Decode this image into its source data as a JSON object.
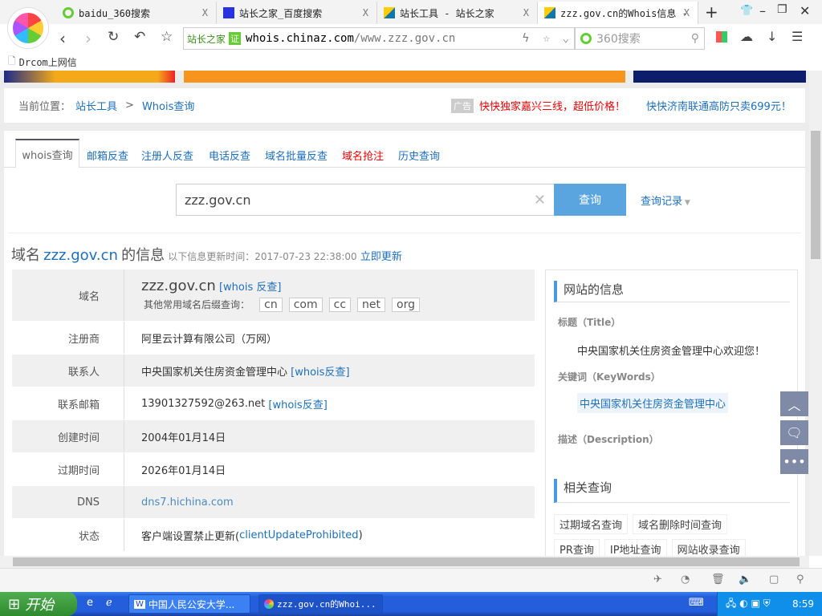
{
  "browser": {
    "tabs": [
      {
        "label": "baidu_360搜索",
        "close": "X"
      },
      {
        "label": "站长之家_百度搜索",
        "close": "X"
      },
      {
        "label": "站长工具 - 站长之家",
        "close": "X"
      },
      {
        "label": "zzz.gov.cn的Whois信息 -",
        "close": "X",
        "active": true
      }
    ],
    "new_tab": "+",
    "address_badge": "站长之家",
    "address_badge_icon": "证",
    "address_host": "whois.chinaz.com",
    "address_path": "/www.zzz.gov.cn",
    "search_placeholder": "360搜索",
    "bookmark": "Drcom上网信"
  },
  "page": {
    "breadcrumb_label": "当前位置：",
    "breadcrumb": [
      "站长工具",
      "Whois查询"
    ],
    "breadcrumb_sep": ">",
    "ad_tag": "广告",
    "ad1": "快快独家嘉兴三线，超低价格！",
    "ad2": "快快济南联通高防只卖699元！",
    "tabs": [
      "whois查询",
      "邮箱反查",
      "注册人反查",
      "电话反查",
      "域名批量反查",
      "域名抢注",
      "历史查询"
    ],
    "query_value": "zzz.gov.cn",
    "query_button": "查询",
    "history": "查询记录",
    "title_prefix": "域名",
    "title_domain": "zzz.gov.cn",
    "title_suffix": "的信息",
    "update_label": "以下信息更新时间：2017-07-23 22:38:00",
    "update_link": "立即更新",
    "domain_row": {
      "label": "域名",
      "value": "zzz.gov.cn",
      "reverse": "[whois 反查]",
      "suffix_label": "其他常用域名后缀查询：",
      "suffixes": [
        "cn",
        "com",
        "cc",
        "net",
        "org"
      ]
    },
    "rows": [
      {
        "label": "注册商",
        "value": "阿里云计算有限公司（万网）"
      },
      {
        "label": "联系人",
        "value": "中央国家机关住房资金管理中心",
        "link": "[whois反查]"
      },
      {
        "label": "联系邮箱",
        "value": "13901327592@263.net",
        "link": "[whois反查]"
      },
      {
        "label": "创建时间",
        "value": "2004年01月14日"
      },
      {
        "label": "过期时间",
        "value": "2026年01月14日"
      },
      {
        "label": "DNS",
        "value": "dns7.hichina.com"
      },
      {
        "label": "状态",
        "value": "客户端设置禁止更新(",
        "link": "clientUpdateProhibited",
        "tail": ")"
      }
    ],
    "side": {
      "site_info": "网站的信息",
      "title_label": "标题（Title）",
      "title_value": "中央国家机关住房资金管理中心欢迎您！",
      "keywords_label": "关键词（KeyWords）",
      "keywords_value": "中央国家机关住房资金管理中心",
      "desc_label": "描述（Description）",
      "related": "相关查询",
      "related_items": [
        "过期域名查询",
        "域名删除时间查询",
        "PR查询",
        "IP地址查询",
        "网站收录查询"
      ]
    }
  },
  "taskbar": {
    "start": "开始",
    "tasks": [
      "中国人民公安大学...",
      "zzz.gov.cn的Whoi..."
    ],
    "clock": "8:59"
  }
}
